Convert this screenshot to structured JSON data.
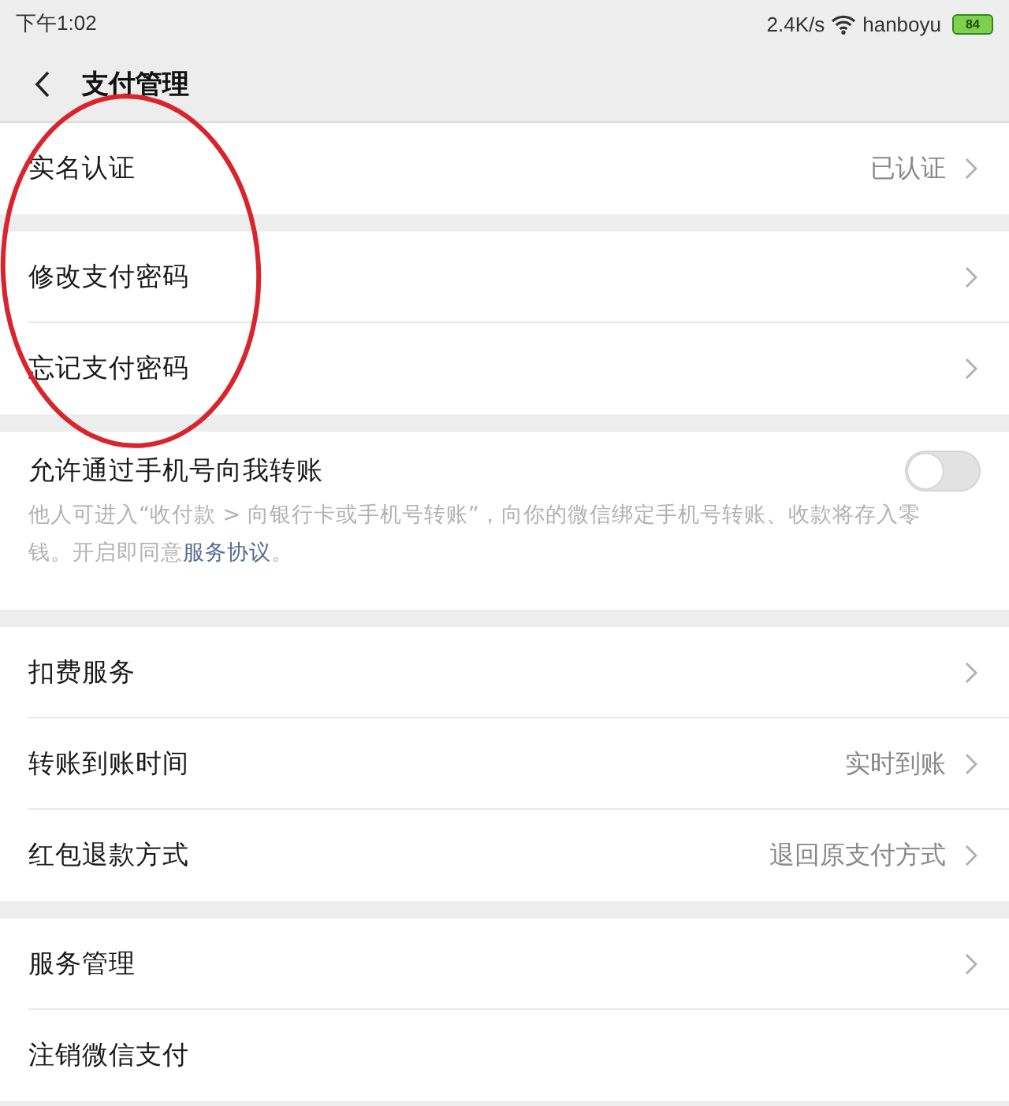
{
  "status_bar": {
    "time": "下午1:02",
    "network_speed": "2.4K/s",
    "carrier": "hanboyu",
    "battery": "84"
  },
  "nav_bar": {
    "title": "支付管理"
  },
  "sections": [
    {
      "items": [
        {
          "kind": "link",
          "label": "实名认证",
          "value": "已认证",
          "chevron": true
        }
      ]
    },
    {
      "items": [
        {
          "kind": "link",
          "label": "修改支付密码",
          "chevron": true
        },
        {
          "kind": "link",
          "label": "忘记支付密码",
          "chevron": true
        }
      ]
    },
    {
      "items": [
        {
          "kind": "toggle",
          "label": "允许通过手机号向我转账",
          "on": false,
          "description": "他人可进入“收付款 > 向银行卡或手机号转账”，向你的微信绑定手机号转账、收款将存入零钱。开启即同意",
          "link": "服务协议",
          "description_end": "。"
        }
      ]
    },
    {
      "items": [
        {
          "kind": "link",
          "label": "扣费服务",
          "chevron": true
        },
        {
          "kind": "link",
          "label": "转账到账时间",
          "value": "实时到账",
          "chevron": true
        },
        {
          "kind": "link",
          "label": "红包退款方式",
          "value": "退回原支付方式",
          "chevron": true
        }
      ]
    },
    {
      "items": [
        {
          "kind": "link",
          "label": "服务管理",
          "chevron": true
        },
        {
          "kind": "link",
          "label": "注销微信支付",
          "chevron": false
        }
      ]
    }
  ],
  "annotations": [
    {
      "kind": "ellipse"
    }
  ]
}
